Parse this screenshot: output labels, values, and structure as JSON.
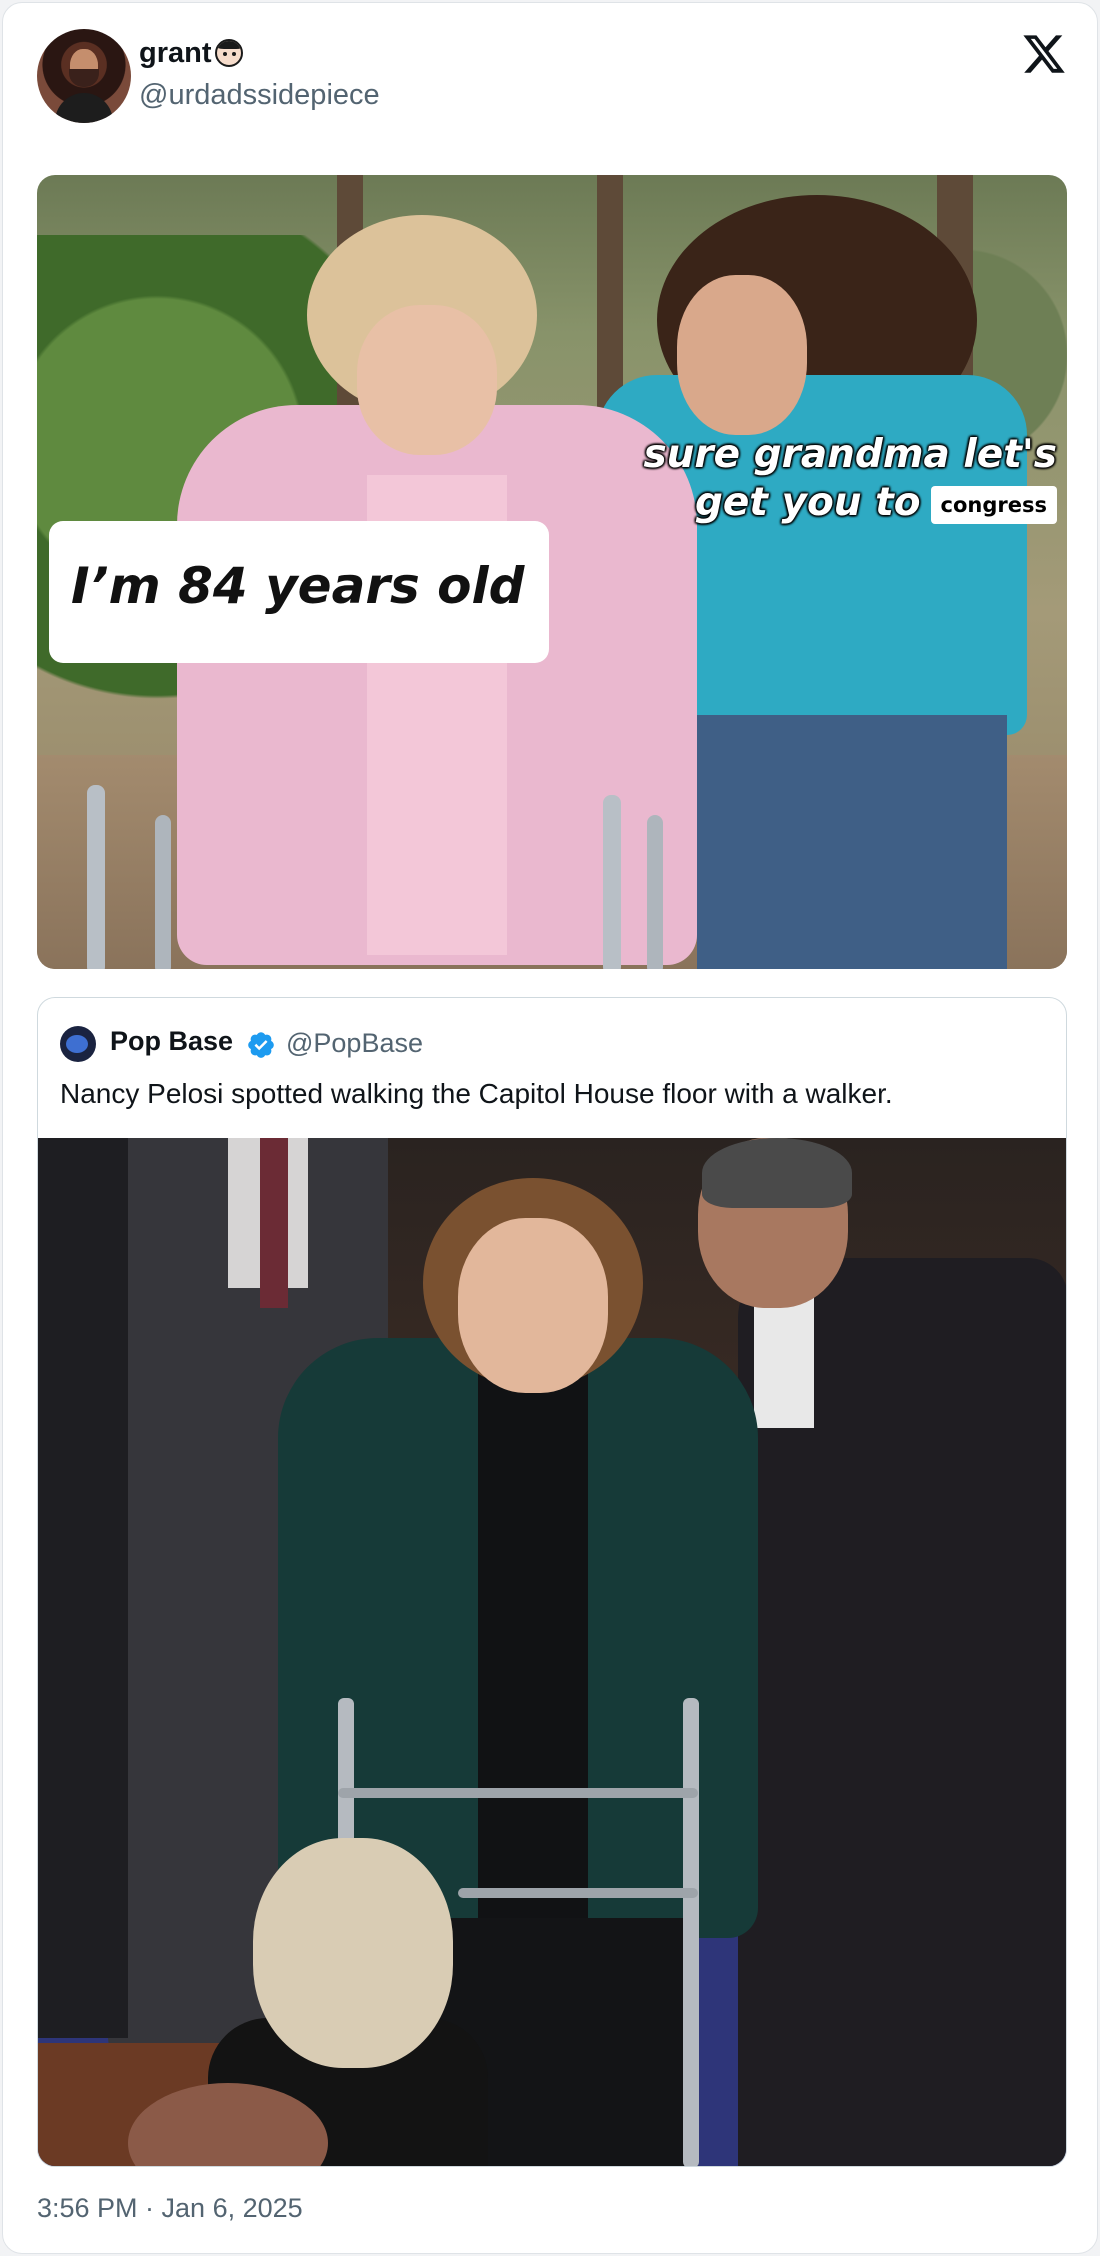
{
  "author": {
    "display_name": "grant",
    "handle": "@urdadssidepiece",
    "avatar_icon": "profile-photo",
    "name_emoji": "person-face-emoji"
  },
  "platform_icon": "x-logo-icon",
  "meme": {
    "left_caption": "I’m 84 years old",
    "right_caption": "sure grandma let's get you to",
    "tag_word": "congress"
  },
  "quoted_post": {
    "display_name": "Pop Base",
    "verified": true,
    "handle": "@PopBase",
    "text": "Nancy Pelosi spotted walking the Capitol House floor with a walker."
  },
  "timestamp": "3:56 PM · Jan 6, 2025",
  "colors": {
    "text_primary": "#0f1419",
    "text_secondary": "#536471",
    "verified_blue": "#1d9bf0",
    "border": "#cfd9de"
  }
}
